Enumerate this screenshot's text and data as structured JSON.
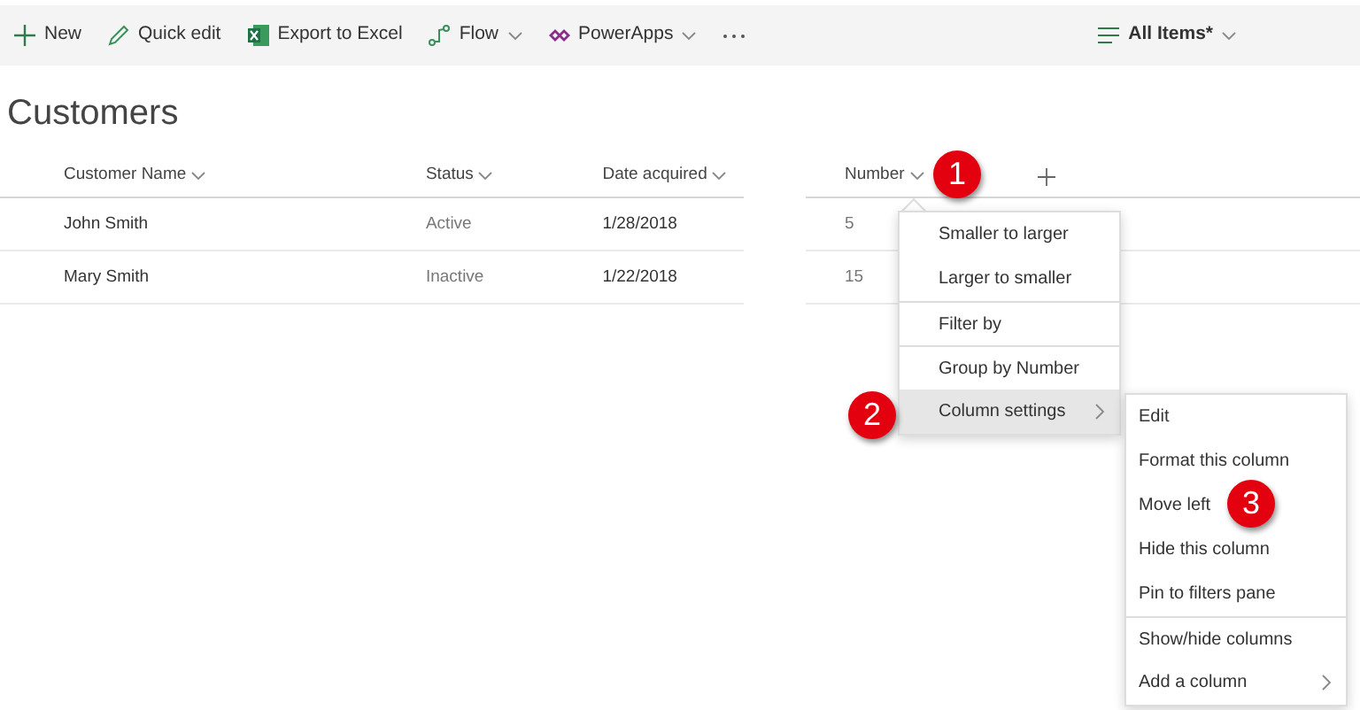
{
  "toolbar": {
    "items": [
      {
        "label": "New",
        "dropdown": false
      },
      {
        "label": "Quick edit",
        "dropdown": false
      },
      {
        "label": "Export to Excel",
        "dropdown": false
      },
      {
        "label": "Flow",
        "dropdown": true
      },
      {
        "label": "PowerApps",
        "dropdown": true
      }
    ],
    "view": {
      "label": "All Items*"
    }
  },
  "title": "Customers",
  "table": {
    "columns": [
      {
        "label": "Customer Name"
      },
      {
        "label": "Status"
      },
      {
        "label": "Date acquired"
      },
      {
        "label": "Number"
      }
    ],
    "rows": [
      [
        "John Smith",
        "Active",
        "1/28/2018",
        "5"
      ],
      [
        "Mary Smith",
        "Inactive",
        "1/22/2018",
        "15"
      ]
    ]
  },
  "menu": {
    "items": [
      {
        "label": "Smaller to larger",
        "selected": false,
        "submenu": false,
        "divider_before": false
      },
      {
        "label": "Larger to smaller",
        "selected": false,
        "submenu": false,
        "divider_before": false
      },
      {
        "label": "Filter by",
        "selected": false,
        "submenu": false,
        "divider_before": true
      },
      {
        "label": "Group by Number",
        "selected": false,
        "submenu": false,
        "divider_before": true
      },
      {
        "label": "Column settings",
        "selected": true,
        "submenu": true,
        "divider_before": false
      }
    ]
  },
  "submenu": {
    "items": [
      {
        "label": "Edit",
        "selected": false,
        "submenu": false,
        "divider_before": false
      },
      {
        "label": "Format this column",
        "selected": false,
        "submenu": false,
        "divider_before": false
      },
      {
        "label": "Move left",
        "selected": false,
        "submenu": false,
        "divider_before": false
      },
      {
        "label": "Hide this column",
        "selected": false,
        "submenu": false,
        "divider_before": false
      },
      {
        "label": "Pin to filters pane",
        "selected": false,
        "submenu": false,
        "divider_before": false
      },
      {
        "label": "Show/hide columns",
        "selected": false,
        "submenu": false,
        "divider_before": true
      },
      {
        "label": "Add a column",
        "selected": false,
        "submenu": true,
        "divider_before": false
      }
    ]
  },
  "callouts": [
    {
      "label": "1"
    },
    {
      "label": "2"
    },
    {
      "label": "3"
    }
  ]
}
